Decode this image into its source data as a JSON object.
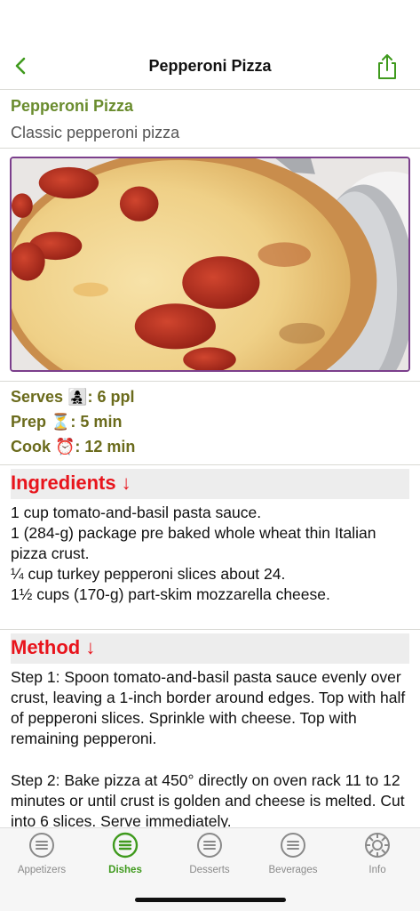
{
  "nav": {
    "title": "Pepperoni Pizza",
    "back_icon": "chevron-left-icon",
    "share_icon": "share-icon"
  },
  "recipe": {
    "name": "Pepperoni Pizza",
    "description": "Classic pepperoni pizza",
    "serves": "Serves 👩‍👧‍👦: 6 ppl",
    "prep": "Prep ⏳: 5 min",
    "cook": "Cook ⏰: 12 min"
  },
  "ingredients": {
    "heading": "Ingredients ↓",
    "text": "1 cup tomato-and-basil pasta sauce.\n1 (284-g) package pre baked whole wheat thin Italian pizza crust.\n¼ cup turkey pepperoni slices about 24.\n1½ cups (170-g) part-skim mozzarella cheese."
  },
  "method": {
    "heading": "Method ↓",
    "step1": "Step 1: Spoon tomato-and-basil pasta sauce evenly over crust, leaving a 1-inch border around edges. Top with half of pepperoni slices. Sprinkle with cheese. Top with remaining pepperoni.",
    "step2": "Step 2: Bake pizza at 450° directly on oven rack 11 to 12 minutes or until crust is golden and cheese is melted. Cut into 6 slices. Serve immediately."
  },
  "tabs": [
    {
      "label": "Appetizers",
      "icon": "list-icon",
      "active": false
    },
    {
      "label": "Dishes",
      "icon": "list-icon",
      "active": true
    },
    {
      "label": "Desserts",
      "icon": "list-icon",
      "active": false
    },
    {
      "label": "Beverages",
      "icon": "list-icon",
      "active": false
    },
    {
      "label": "Info",
      "icon": "gear-icon",
      "active": false
    }
  ],
  "colors": {
    "accent_green": "#3f9a1d",
    "section_red": "#e8141c",
    "title_green": "#6a8c2e",
    "stat_olive": "#6b6b1c",
    "photo_border": "#7b3f8c"
  }
}
